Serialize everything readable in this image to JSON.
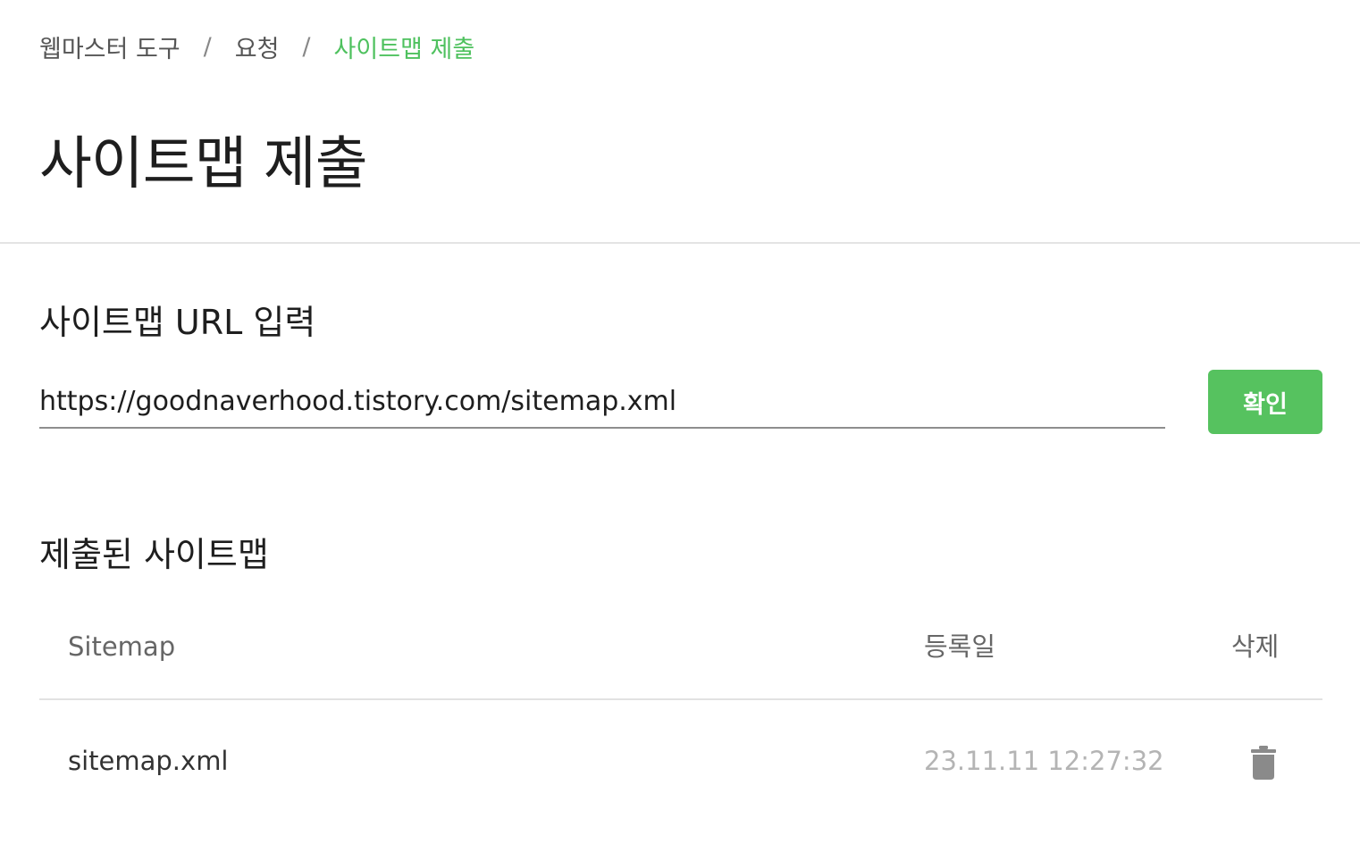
{
  "breadcrumb": {
    "items": [
      {
        "label": "웹마스터 도구"
      },
      {
        "label": "요청"
      },
      {
        "label": "사이트맵 제출"
      }
    ],
    "separator": "/"
  },
  "page": {
    "title": "사이트맵 제출"
  },
  "url_section": {
    "title": "사이트맵 URL 입력",
    "input_value": "https://goodnaverhood.tistory.com/sitemap.xml",
    "confirm_label": "확인"
  },
  "submitted_section": {
    "title": "제출된 사이트맵",
    "columns": {
      "sitemap": "Sitemap",
      "date": "등록일",
      "delete": "삭제"
    },
    "rows": [
      {
        "sitemap": "sitemap.xml",
        "date": "23.11.11 12:27:32",
        "delete_icon": "trash-icon"
      }
    ]
  },
  "colors": {
    "accent": "#4ec15e",
    "breadcrumb_current": "#4ec15e",
    "button_bg": "#56c25f",
    "trash_icon": "#8a8a8a"
  }
}
